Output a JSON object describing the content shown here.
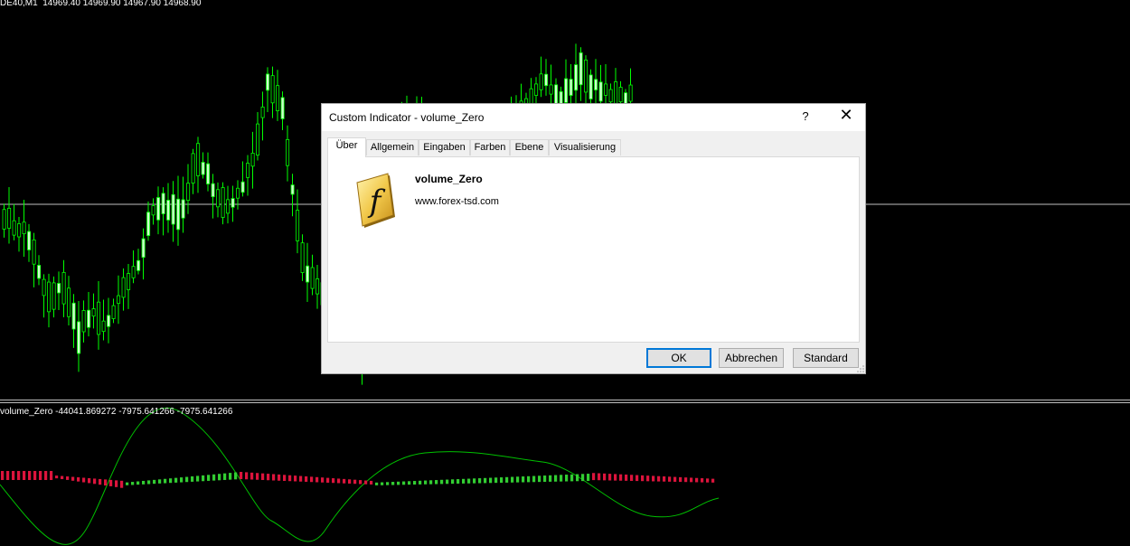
{
  "main_chart": {
    "label": "DE40,M1  14969.40 14969.90 14967.90 14968.90",
    "colors": {
      "background": "#000000",
      "candle": "#00ff00",
      "bull_body": "#ccffcc",
      "hline": "#c0c0c0"
    }
  },
  "sub_chart": {
    "label": "volume_Zero -44041.869272 -7975.641266 -7975.641266",
    "colors": {
      "line": "#00c000",
      "negative": "#dc143c",
      "positive": "#32cd32"
    }
  },
  "dialog": {
    "title": "Custom Indicator - volume_Zero",
    "help": "?",
    "close": "✕",
    "tabs": [
      "Über",
      "Allgemein",
      "Eingaben",
      "Farben",
      "Ebene",
      "Visualisierung"
    ],
    "active_tab": "Über",
    "indicator": {
      "icon": "function-f-icon",
      "icon_letter": "f",
      "name": "volume_Zero",
      "url": "www.forex-tsd.com"
    },
    "buttons": {
      "ok": "OK",
      "cancel": "Abbrechen",
      "standard": "Standard"
    }
  }
}
